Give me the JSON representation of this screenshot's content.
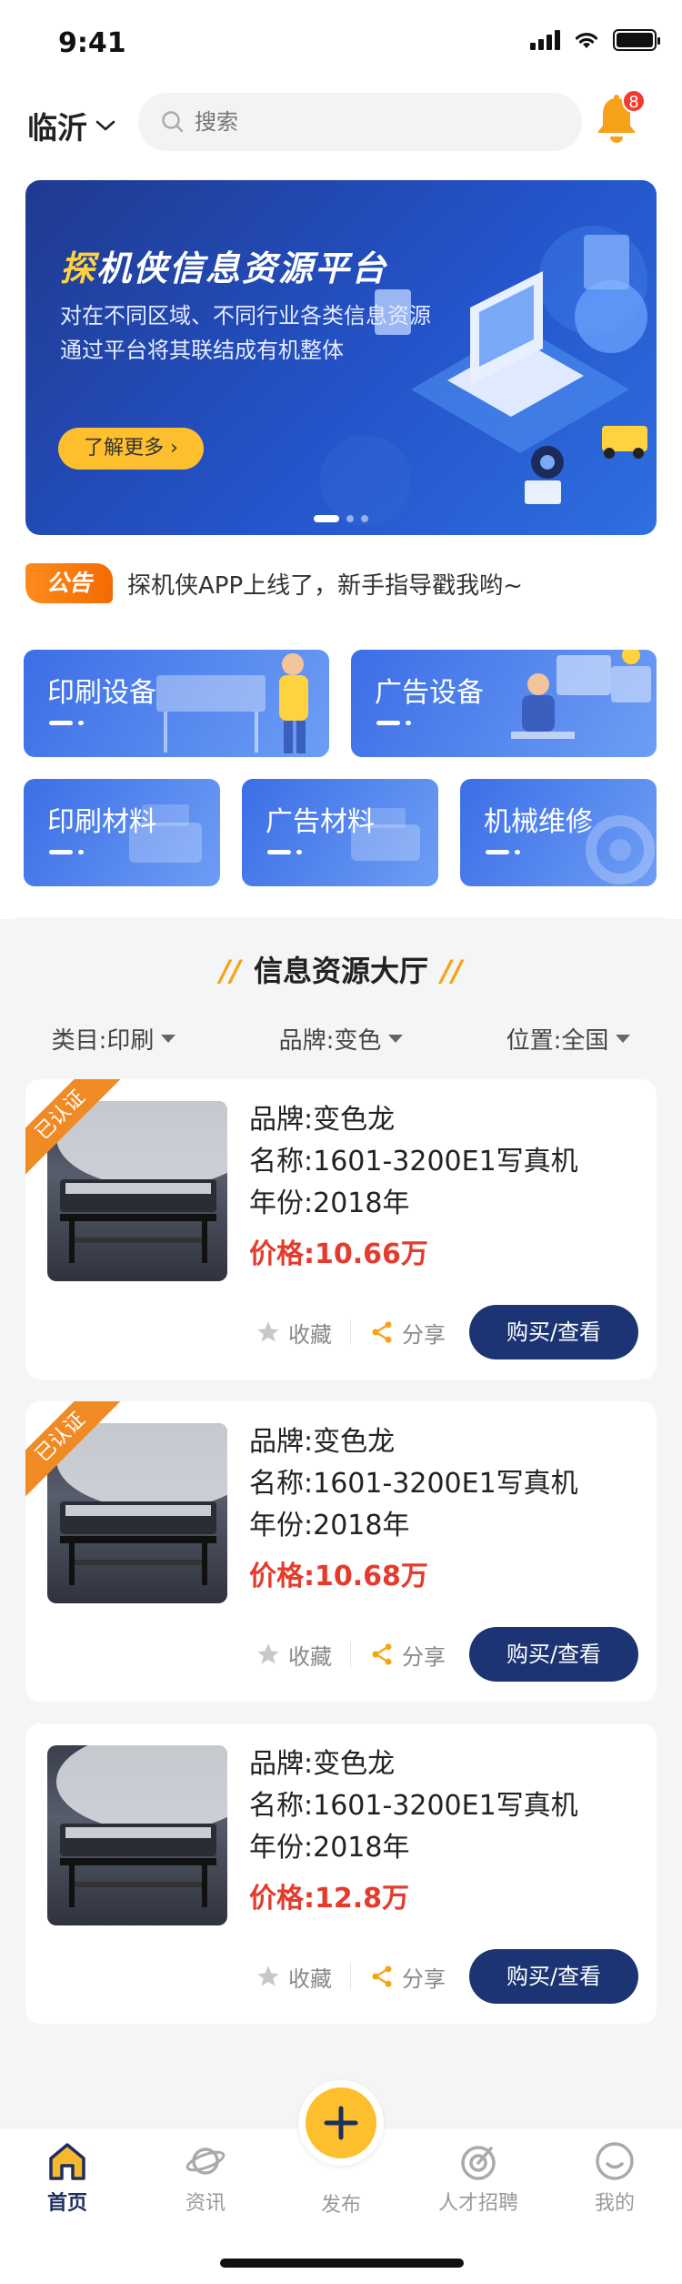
{
  "status": {
    "time": "9:41"
  },
  "header": {
    "city": "临沂",
    "search_placeholder": "搜索",
    "notification_count": "8"
  },
  "banner": {
    "title_highlight": "探",
    "title_rest": "机侠信息资源平台",
    "desc_line1": "对在不同区域、不同行业各类信息资源",
    "desc_line2": "通过平台将其联结成有机整体",
    "button": "了解更多",
    "slide_count": 3,
    "active_slide": 1
  },
  "notice": {
    "tag": "公告",
    "text": "探机侠APP上线了，新手指导戳我哟~"
  },
  "categories": [
    {
      "label": "印刷设备"
    },
    {
      "label": "广告设备"
    },
    {
      "label": "印刷材料"
    },
    {
      "label": "广告材料"
    },
    {
      "label": "机械维修"
    }
  ],
  "hall": {
    "title": "信息资源大厅",
    "filters": [
      {
        "label": "类目:印刷"
      },
      {
        "label": "品牌:变色"
      },
      {
        "label": "位置:全国"
      }
    ]
  },
  "listings": [
    {
      "badge": "已认证",
      "brand": "品牌:变色龙",
      "name": "名称:1601-3200E1写真机",
      "year": "年份:2018年",
      "price": "价格:10.66万",
      "collect": "收藏",
      "share": "分享",
      "buy": "购买/查看"
    },
    {
      "badge": "已认证",
      "brand": "品牌:变色龙",
      "name": "名称:1601-3200E1写真机",
      "year": "年份:2018年",
      "price": "价格:10.68万",
      "collect": "收藏",
      "share": "分享",
      "buy": "购买/查看"
    },
    {
      "badge": "",
      "brand": "品牌:变色龙",
      "name": "名称:1601-3200E1写真机",
      "year": "年份:2018年",
      "price": "价格:12.8万",
      "collect": "收藏",
      "share": "分享",
      "buy": "购买/查看"
    }
  ],
  "tabbar": {
    "home": "首页",
    "news": "资讯",
    "publish": "发布",
    "jobs": "人才招聘",
    "mine": "我的"
  },
  "colors": {
    "accent": "#fdbf2d",
    "primary": "#1d3474",
    "price": "#e43b2c",
    "brand_blue": "#2453c9"
  }
}
